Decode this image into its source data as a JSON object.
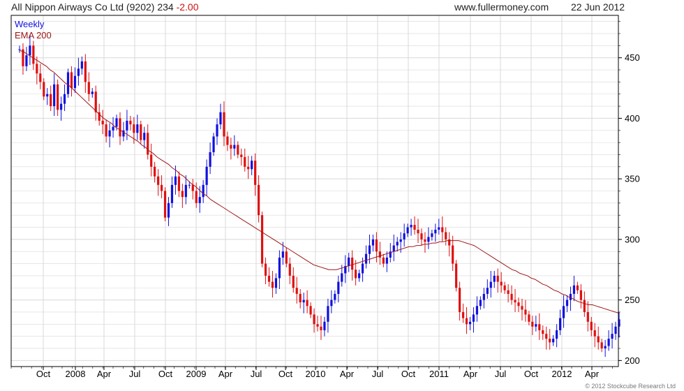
{
  "header": {
    "title": "All Nippon Airways Co Ltd (9202) 234",
    "change": "-2.00",
    "site": "www.fullermoney.com",
    "date": "22 Jun 2012"
  },
  "footer": {
    "copyright": "© 2012 Stockcube Research Ltd"
  },
  "colors": {
    "up": "#1010e0",
    "down": "#e01010",
    "ema": "#a01818",
    "grid": "#d8d8d8",
    "frame": "#000000"
  },
  "chart_data": {
    "type": "candlestick",
    "legend": [
      "Weekly",
      "EMA 200"
    ],
    "x_ticks": [
      "Oct",
      "2008",
      "Apr",
      "Jul",
      "Oct",
      "2009",
      "Apr",
      "Jul",
      "Oct",
      "2010",
      "Apr",
      "Jul",
      "Oct",
      "2011",
      "Apr",
      "Jul",
      "Oct",
      "2012",
      "Apr"
    ],
    "y_ticks": [
      200,
      250,
      300,
      350,
      400,
      450
    ],
    "ylim": [
      195,
      485
    ],
    "grid": true,
    "close_series": [
      457,
      443,
      452,
      460,
      445,
      437,
      430,
      418,
      420,
      410,
      428,
      407,
      412,
      420,
      438,
      425,
      435,
      441,
      447,
      430,
      420,
      422,
      405,
      398,
      395,
      385,
      390,
      393,
      400,
      385,
      390,
      398,
      395,
      388,
      395,
      382,
      388,
      370,
      360,
      352,
      345,
      340,
      318,
      330,
      345,
      352,
      340,
      335,
      345,
      345,
      340,
      330,
      335,
      345,
      360,
      372,
      385,
      395,
      405,
      385,
      378,
      375,
      378,
      370,
      368,
      360,
      358,
      365,
      345,
      320,
      280,
      270,
      265,
      260,
      268,
      285,
      290,
      280,
      270,
      260,
      255,
      248,
      250,
      245,
      238,
      230,
      228,
      225,
      232,
      245,
      250,
      255,
      265,
      272,
      278,
      285,
      275,
      268,
      272,
      280,
      288,
      295,
      300,
      290,
      285,
      280,
      285,
      290,
      295,
      298,
      300,
      305,
      310,
      312,
      308,
      305,
      300,
      298,
      302,
      305,
      308,
      310,
      306,
      300,
      295,
      280,
      260,
      240,
      235,
      230,
      232,
      238,
      245,
      250,
      255,
      260,
      265,
      270,
      265,
      262,
      258,
      255,
      250,
      248,
      245,
      242,
      238,
      232,
      228,
      230,
      225,
      222,
      218,
      215,
      218,
      225,
      235,
      245,
      250,
      255,
      262,
      258,
      250,
      240,
      232,
      225,
      220,
      215,
      210,
      212,
      218,
      222,
      228,
      234
    ],
    "ema_200": [
      456,
      455,
      453,
      451,
      449,
      447,
      445,
      443,
      440,
      438,
      435,
      432,
      429,
      427,
      424,
      421,
      418,
      415,
      412,
      409,
      406,
      403,
      400,
      398,
      396,
      393,
      391,
      389,
      387,
      385,
      383,
      381,
      378,
      376,
      373,
      371,
      368,
      366,
      364,
      362,
      359,
      357,
      354,
      352,
      349,
      346,
      344,
      341,
      338,
      336,
      333,
      331,
      329,
      327,
      325,
      323,
      321,
      319,
      317,
      315,
      313,
      311,
      309,
      307,
      305,
      303,
      301,
      299,
      297,
      295,
      293,
      291,
      289,
      287,
      285,
      283,
      281,
      279,
      278,
      277,
      276,
      275,
      275,
      275,
      276,
      277,
      278,
      279,
      280,
      281,
      282,
      283,
      284,
      285,
      286,
      287,
      288,
      289,
      290,
      291,
      292,
      293,
      294,
      294,
      295,
      295,
      296,
      296,
      297,
      297,
      298,
      298,
      299,
      299,
      299,
      299,
      298,
      297,
      296,
      295,
      293,
      291,
      289,
      287,
      285,
      283,
      281,
      279,
      277,
      275,
      274,
      272,
      271,
      270,
      268,
      267,
      265,
      263,
      262,
      260,
      258,
      257,
      255,
      254,
      252,
      251,
      249,
      248,
      247,
      246,
      246,
      245,
      244,
      243,
      242,
      241,
      240,
      239
    ]
  }
}
